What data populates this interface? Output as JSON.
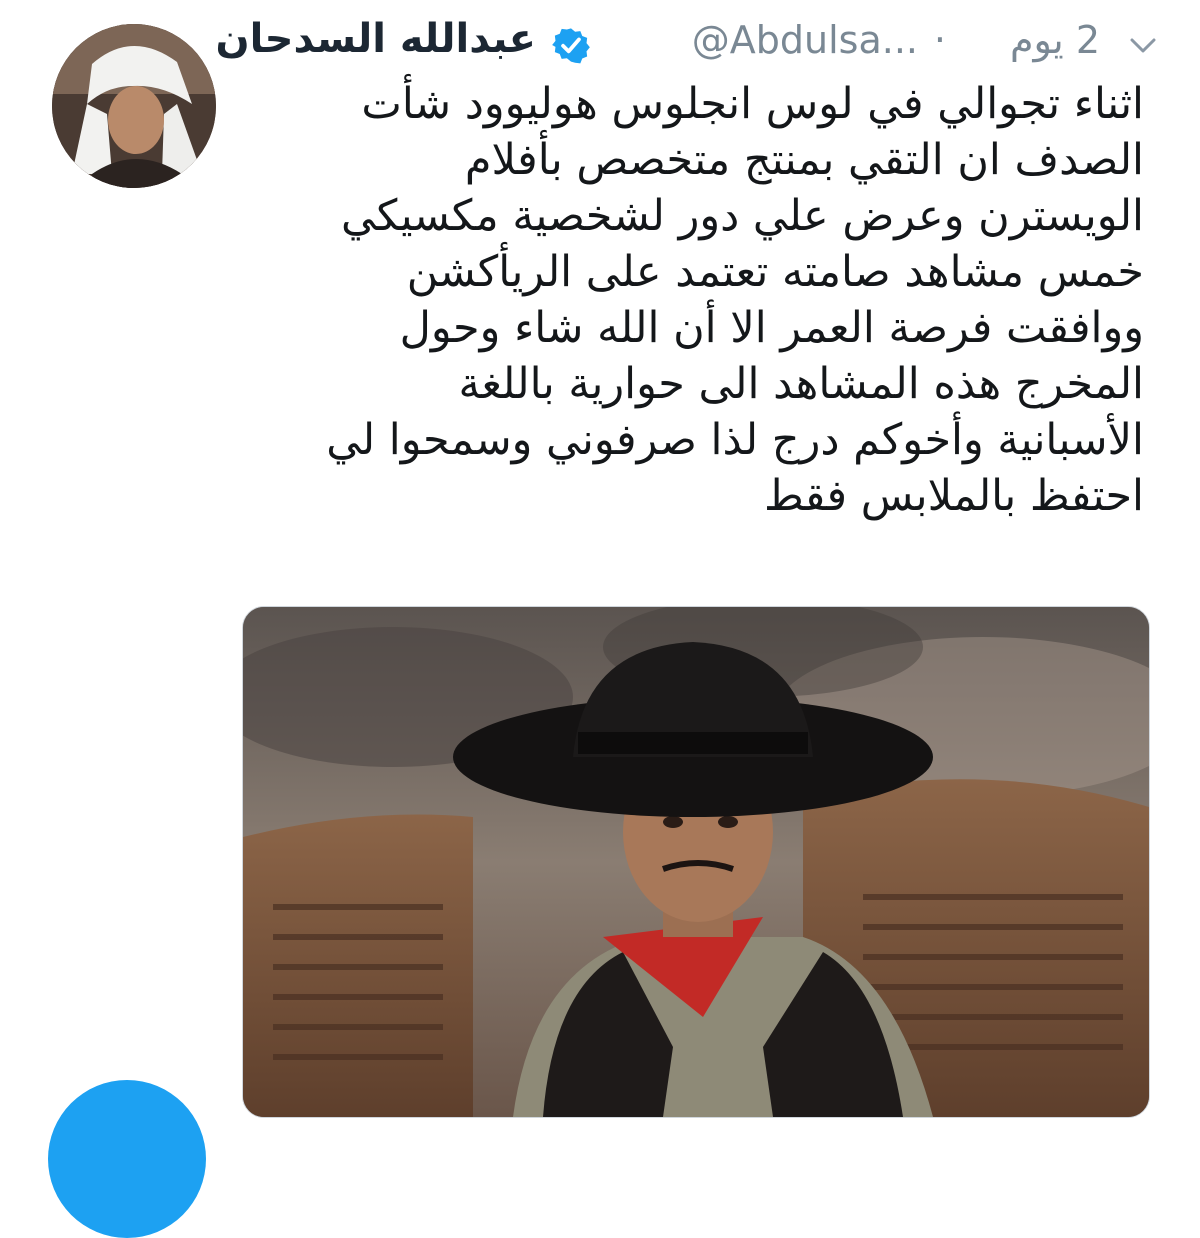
{
  "tweet": {
    "author_name": "عبدالله السدحان",
    "handle": "@Abdulsa...",
    "separator": "·",
    "time": "2 يوم",
    "lines": [
      "اثناء تجوالي في لوس انجلوس هوليوود شأت",
      "الصدف ان التقي بمنتج متخصص بأفلام",
      "الويسترن وعرض علي دور لشخصية مكسيكي",
      "خمس مشاهد صامته تعتمد على الريأكشن",
      "ووافقت فرصة العمر الا أن الله شاء وحول",
      "المخرج هذه المشاهد الى حوارية باللغة",
      "الأسبانية وأخوكم درج لذا صرفوني وسمحوا لي",
      "احتفظ بالملابس فقط"
    ]
  },
  "colors": {
    "meta_gray": "#7a8894",
    "verified_blue": "#1da1f2",
    "text": "#14171a",
    "fab_blue": "#1da1f2"
  },
  "icons": {
    "verified": "verified-badge-icon",
    "chevron": "chevron-down-icon"
  }
}
